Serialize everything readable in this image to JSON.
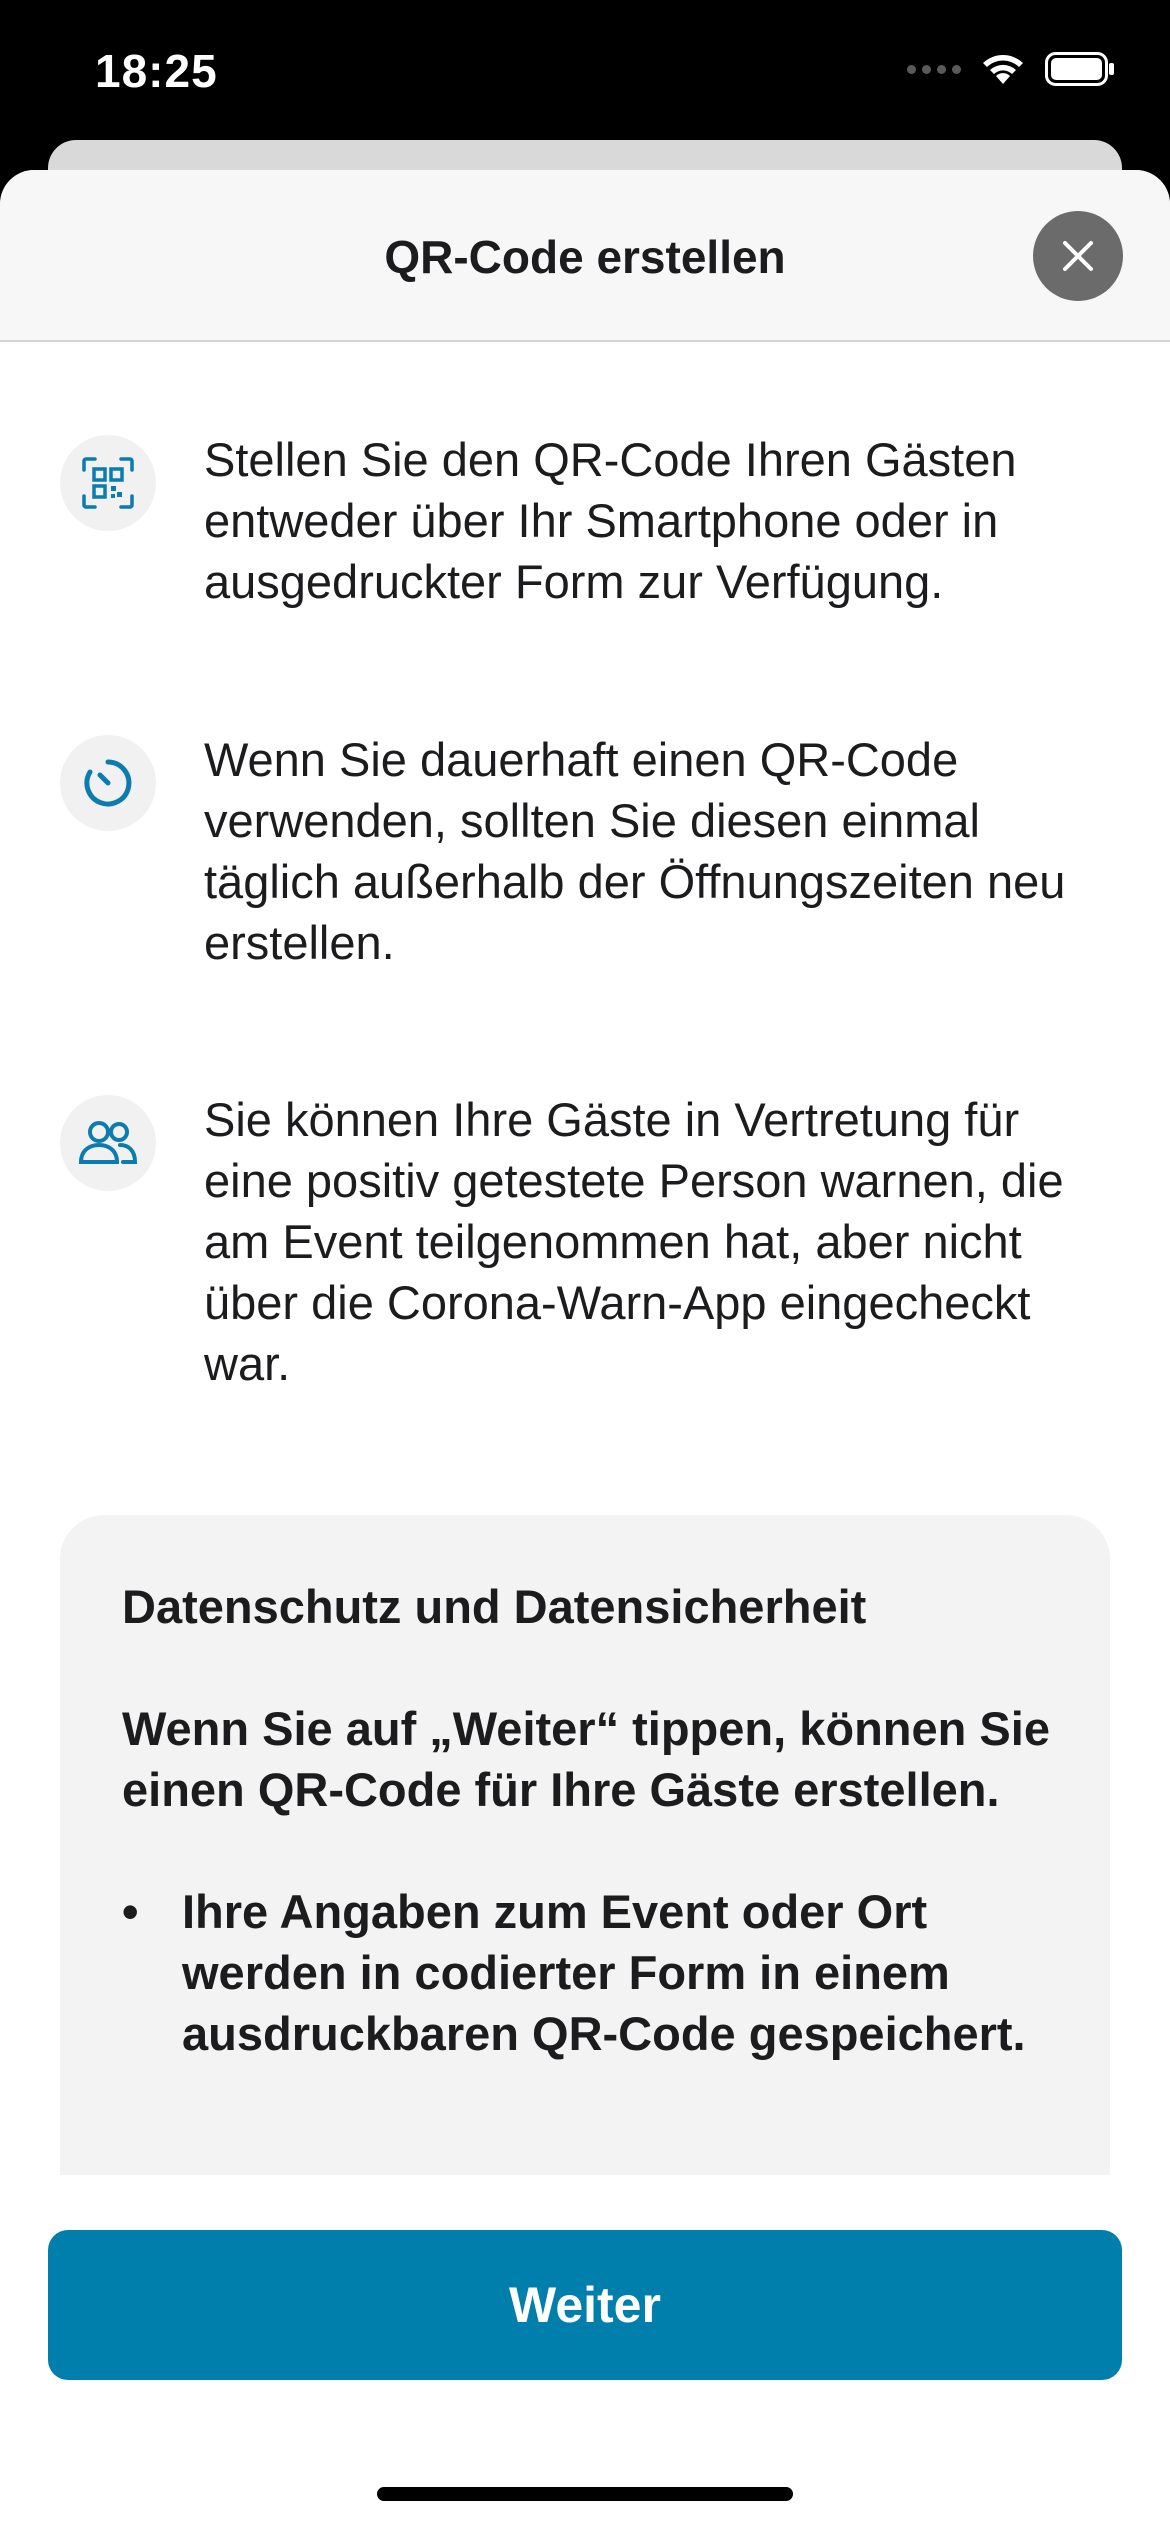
{
  "status_bar": {
    "time": "18:25"
  },
  "header": {
    "title": "QR-Code erstellen"
  },
  "info_items": [
    {
      "icon": "qr-code-icon",
      "text": "Stellen Sie den QR-Code Ihren Gästen entweder über Ihr Smartphone oder in ausgedruckter Form zur Verfügung."
    },
    {
      "icon": "timer-icon",
      "text": "Wenn Sie dauerhaft einen QR-Code verwenden, sollten Sie diesen einmal täglich außerhalb der Öffnungszeiten neu erstellen."
    },
    {
      "icon": "group-icon",
      "text": "Sie können Ihre Gäste in Vertretung für eine positiv getestete Person warnen, die am Event teilgenommen hat, aber nicht über die Corona-Warn-App eingecheckt war."
    }
  ],
  "privacy": {
    "title": "Datenschutz und Datensicherheit",
    "body": "Wenn Sie auf „Weiter“ tippen, können Sie einen QR-Code für Ihre Gäste erstellen.",
    "bullets": [
      "Ihre Angaben zum Event oder Ort werden in codierter Form in einem ausdruckbaren QR-Code gespeichert."
    ]
  },
  "footer": {
    "continue_label": "Weiter"
  },
  "colors": {
    "accent": "#007fad",
    "icon_blue": "#0b7bb0",
    "close_bg": "#6b6b6b"
  }
}
